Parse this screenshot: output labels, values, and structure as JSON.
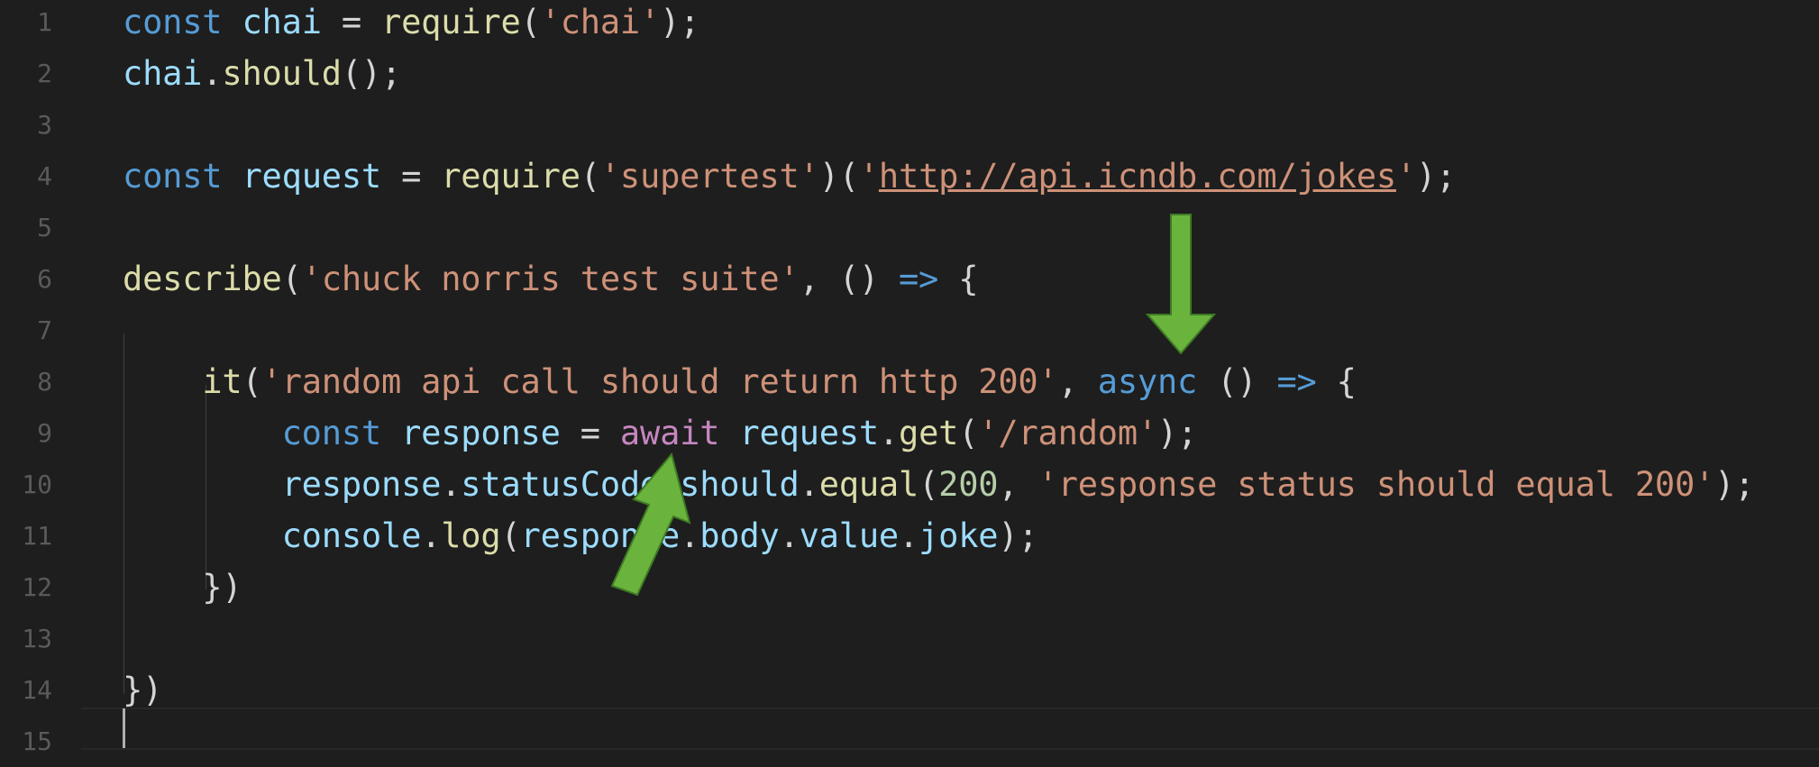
{
  "editor": {
    "line_numbers": [
      "1",
      "2",
      "3",
      "4",
      "5",
      "6",
      "7",
      "8",
      "9",
      "10",
      "11",
      "12",
      "13",
      "14",
      "15"
    ],
    "lines": [
      [
        {
          "c": "kw",
          "t": "const"
        },
        {
          "c": "",
          "t": " "
        },
        {
          "c": "var",
          "t": "chai"
        },
        {
          "c": "",
          "t": " = "
        },
        {
          "c": "fn",
          "t": "require"
        },
        {
          "c": "",
          "t": "("
        },
        {
          "c": "str",
          "t": "'chai'"
        },
        {
          "c": "",
          "t": ");"
        }
      ],
      [
        {
          "c": "var",
          "t": "chai"
        },
        {
          "c": "",
          "t": "."
        },
        {
          "c": "fn",
          "t": "should"
        },
        {
          "c": "",
          "t": "();"
        }
      ],
      [],
      [
        {
          "c": "kw",
          "t": "const"
        },
        {
          "c": "",
          "t": " "
        },
        {
          "c": "var",
          "t": "request"
        },
        {
          "c": "",
          "t": " = "
        },
        {
          "c": "fn",
          "t": "require"
        },
        {
          "c": "",
          "t": "("
        },
        {
          "c": "str",
          "t": "'supertest'"
        },
        {
          "c": "",
          "t": ")("
        },
        {
          "c": "str",
          "t": "'"
        },
        {
          "c": "str url",
          "t": "http://api.icndb.com/jokes"
        },
        {
          "c": "str",
          "t": "'"
        },
        {
          "c": "",
          "t": ");"
        }
      ],
      [],
      [
        {
          "c": "fn",
          "t": "describe"
        },
        {
          "c": "",
          "t": "("
        },
        {
          "c": "str",
          "t": "'chuck norris test suite'"
        },
        {
          "c": "",
          "t": ", () "
        },
        {
          "c": "kw",
          "t": "=>"
        },
        {
          "c": "",
          "t": " {"
        }
      ],
      [],
      [
        {
          "c": "",
          "t": "    "
        },
        {
          "c": "fn",
          "t": "it"
        },
        {
          "c": "",
          "t": "("
        },
        {
          "c": "str",
          "t": "'random api call should return http 200'"
        },
        {
          "c": "",
          "t": ", "
        },
        {
          "c": "kw",
          "t": "async"
        },
        {
          "c": "",
          "t": " () "
        },
        {
          "c": "kw",
          "t": "=>"
        },
        {
          "c": "",
          "t": " {"
        }
      ],
      [
        {
          "c": "",
          "t": "        "
        },
        {
          "c": "kw",
          "t": "const"
        },
        {
          "c": "",
          "t": " "
        },
        {
          "c": "var",
          "t": "response"
        },
        {
          "c": "",
          "t": " = "
        },
        {
          "c": "ctl",
          "t": "await"
        },
        {
          "c": "",
          "t": " "
        },
        {
          "c": "var",
          "t": "request"
        },
        {
          "c": "",
          "t": "."
        },
        {
          "c": "fn",
          "t": "get"
        },
        {
          "c": "",
          "t": "("
        },
        {
          "c": "str",
          "t": "'/random'"
        },
        {
          "c": "",
          "t": ");"
        }
      ],
      [
        {
          "c": "",
          "t": "        "
        },
        {
          "c": "var",
          "t": "response"
        },
        {
          "c": "",
          "t": "."
        },
        {
          "c": "var",
          "t": "statusCode"
        },
        {
          "c": "",
          "t": "."
        },
        {
          "c": "var",
          "t": "should"
        },
        {
          "c": "",
          "t": "."
        },
        {
          "c": "fn",
          "t": "equal"
        },
        {
          "c": "",
          "t": "("
        },
        {
          "c": "num",
          "t": "200"
        },
        {
          "c": "",
          "t": ", "
        },
        {
          "c": "str",
          "t": "'response status should equal 200'"
        },
        {
          "c": "",
          "t": ");"
        }
      ],
      [
        {
          "c": "",
          "t": "        "
        },
        {
          "c": "var",
          "t": "console"
        },
        {
          "c": "",
          "t": "."
        },
        {
          "c": "fn",
          "t": "log"
        },
        {
          "c": "",
          "t": "("
        },
        {
          "c": "var",
          "t": "response"
        },
        {
          "c": "",
          "t": "."
        },
        {
          "c": "var",
          "t": "body"
        },
        {
          "c": "",
          "t": "."
        },
        {
          "c": "var",
          "t": "value"
        },
        {
          "c": "",
          "t": "."
        },
        {
          "c": "var",
          "t": "joke"
        },
        {
          "c": "",
          "t": ");"
        }
      ],
      [
        {
          "c": "",
          "t": "    })"
        }
      ],
      [],
      [
        {
          "c": "",
          "t": "})"
        }
      ],
      []
    ]
  },
  "annotations": {
    "arrow_color": "#6ab43e",
    "arrows": [
      "arrow-pointing-down-at-async",
      "arrow-pointing-up-at-await"
    ]
  }
}
